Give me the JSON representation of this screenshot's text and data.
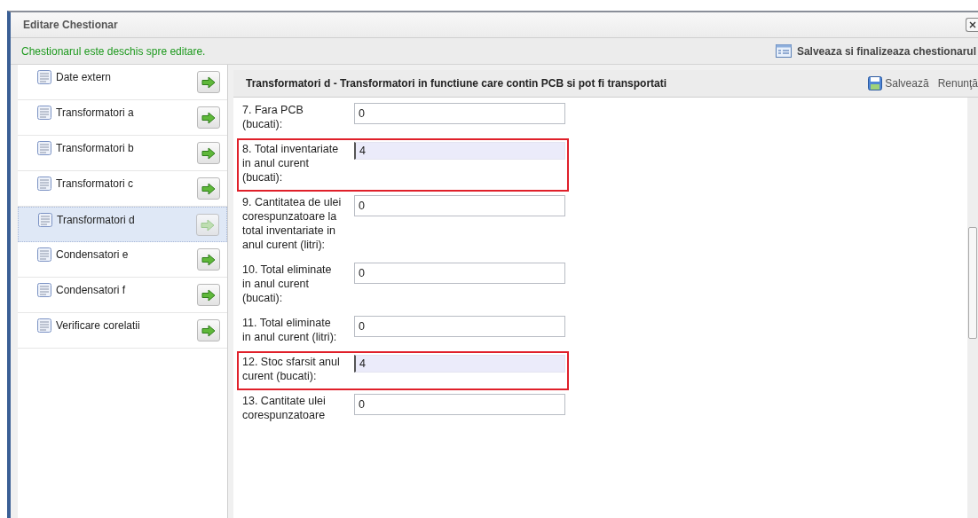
{
  "window": {
    "title": "Editare Chestionar"
  },
  "status_message": "Chestionarul este deschis spre editare.",
  "finalize_button": "Salveaza si finalizeaza chestionarul",
  "sidebar": {
    "items": [
      {
        "label": "Date extern",
        "selected": false
      },
      {
        "label": "Transformatori a",
        "selected": false
      },
      {
        "label": "Transformatori b",
        "selected": false
      },
      {
        "label": "Transformatori c",
        "selected": false
      },
      {
        "label": "Transformatori d",
        "selected": true
      },
      {
        "label": "Condensatori e",
        "selected": false
      },
      {
        "label": "Condensatori f",
        "selected": false
      },
      {
        "label": "Verificare corelatii",
        "selected": false
      }
    ]
  },
  "panel": {
    "title": "Transformatori d - Transformatori in functiune care contin PCB si pot fi transportati",
    "save_button": "Salvează",
    "cancel_button": "Renunţă"
  },
  "fields": [
    {
      "label": "7. Fara PCB (bucati):",
      "value": "0",
      "highlighted": false
    },
    {
      "label": "8. Total inventariate in anul curent (bucati):",
      "value": "4",
      "highlighted": true
    },
    {
      "label": "9. Cantitatea de ulei corespunzatoare la total inventariate in anul curent (litri):",
      "value": "0",
      "highlighted": false
    },
    {
      "label": "10. Total eliminate in anul curent (bucati):",
      "value": "0",
      "highlighted": false
    },
    {
      "label": "11. Total eliminate in anul curent (litri):",
      "value": "0",
      "highlighted": false
    },
    {
      "label": "12. Stoc sfarsit anul curent (bucati):",
      "value": "4",
      "highlighted": true
    },
    {
      "label": "13. Cantitate ulei corespunzatoare",
      "value": "0",
      "highlighted": false
    }
  ]
}
